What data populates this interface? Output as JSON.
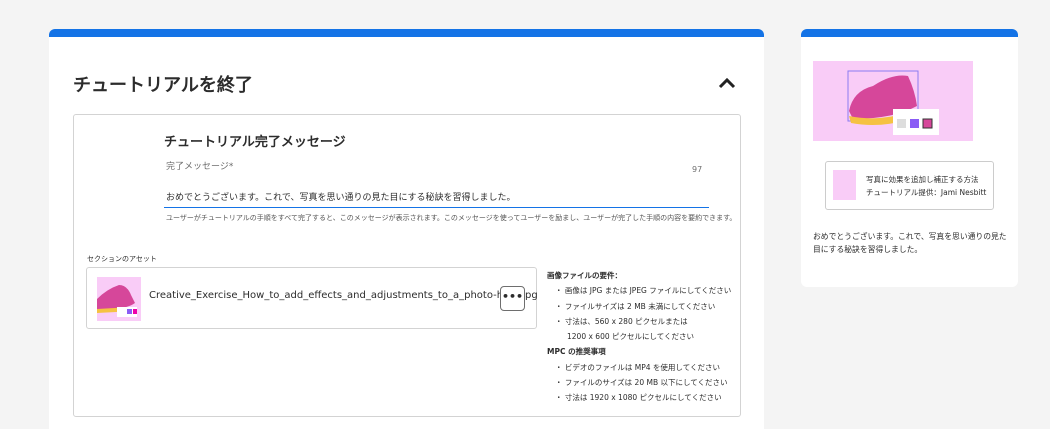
{
  "main": {
    "title": "チュートリアルを終了",
    "section_title": "チュートリアル完了メッセージ",
    "field_label": "完了メッセージ*",
    "char_count": "97",
    "field_value": "おめでとうございます。これで、写真を思い通りの見た目にする秘訣を習得しました。",
    "help_text": "ユーザーがチュートリアルの手順をすべて完了すると、このメッセージが表示されます。このメッセージを使ってユーザーを励まし、ユーザーが完了した手順の内容を要約できます。",
    "assets_label": "セクションのアセット",
    "asset_filename": "Creative_Exercise_How_to_add_effects_and_adjustments_to_a_photo-hero.jpg",
    "more_label": "•••",
    "requirements": {
      "image_heading": "画像ファイルの要件：",
      "image_items": [
        "・ 画像は JPG または JPEG ファイルにしてください",
        "・ ファイルサイズは 2 MB 未満にしてください",
        "・ 寸法は、560 x 280 ピクセルまたは"
      ],
      "image_cont": "1200 x 600 ピクセルにしてください",
      "mpc_heading": "MPC の推奨事項",
      "mpc_items": [
        "・ ビデオのファイルは MP4 を使用してください",
        "・ ファイルのサイズは 20 MB 以下にしてください",
        "・ 寸法は 1920 x 1080 ピクセルにしてください"
      ]
    }
  },
  "side": {
    "tutorial_title": "写真に効果を追加し補正する方法",
    "tutorial_author": "チュートリアル提供：Jami Nesbitt",
    "message": "おめでとうございます。これで、写真を思い通りの見た目にする秘訣を習得しました。"
  },
  "colors": {
    "accent": "#1473e6",
    "thumb_bg": "#f9ccf7"
  }
}
